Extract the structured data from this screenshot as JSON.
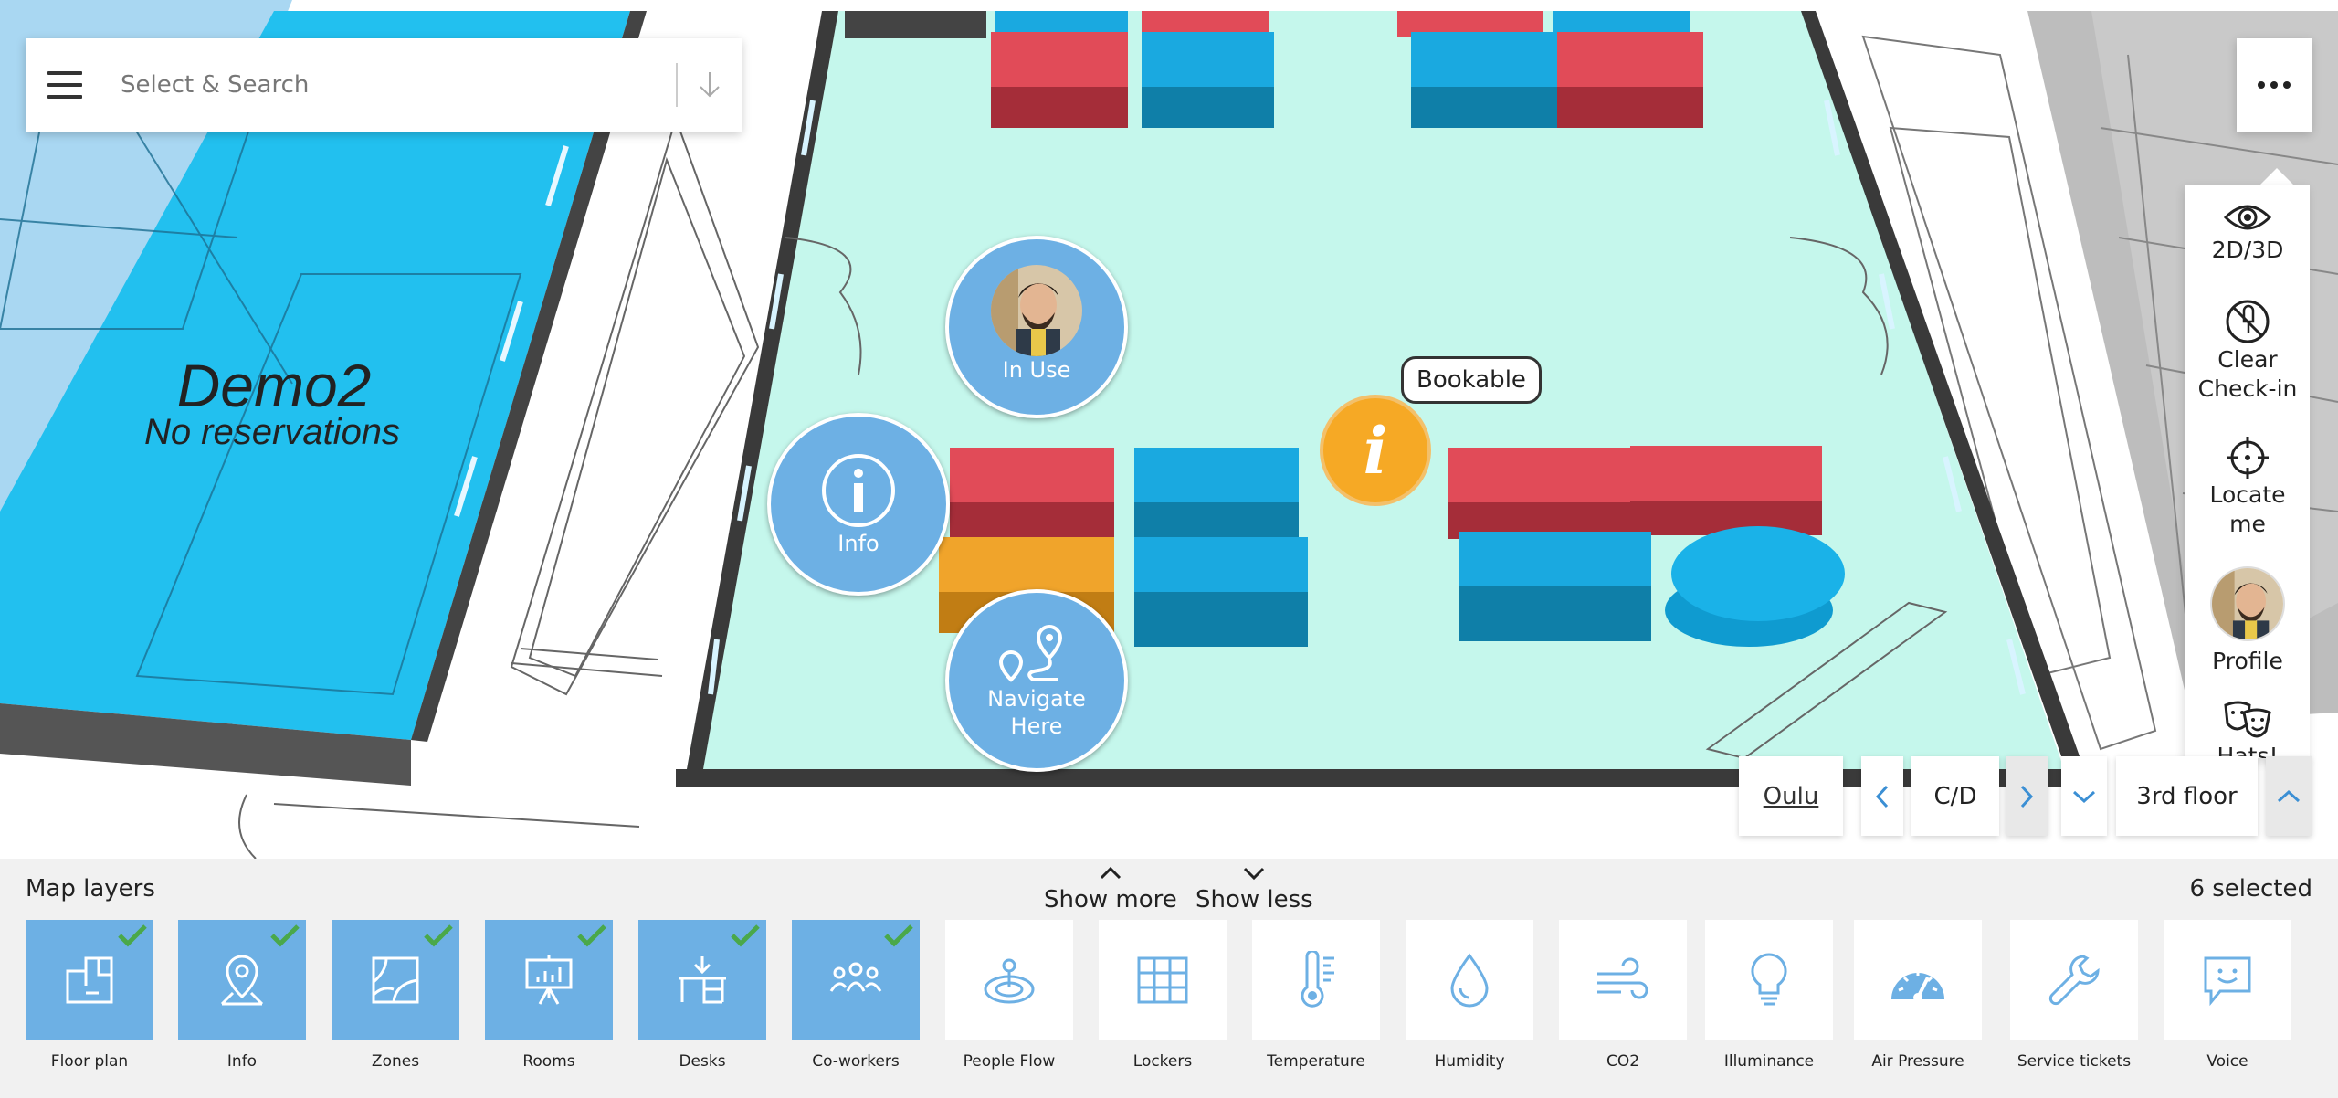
{
  "search": {
    "placeholder": "Select & Search"
  },
  "map": {
    "room_label_line1": "Demo2",
    "room_label_line2": "No reservations",
    "markers": {
      "in_use": "In Use",
      "info": "Info",
      "navigate": "Navigate\nHere",
      "bookable": "Bookable",
      "info_pin_glyph": "i"
    }
  },
  "toolbar": {
    "more_icon": "ellipsis-icon",
    "items": [
      {
        "label": "2D/3D",
        "icon": "eye-icon"
      },
      {
        "label": "Clear\nCheck-in",
        "icon": "clear-checkin-icon"
      },
      {
        "label": "Locate\nme",
        "icon": "crosshair-icon"
      },
      {
        "label": "Profile",
        "icon": "avatar"
      },
      {
        "label": "Hats!",
        "icon": "theater-masks-icon"
      }
    ]
  },
  "floor_selector": {
    "site": "Oulu",
    "building": "C/D",
    "floor": "3rd floor"
  },
  "layers_panel": {
    "title": "Map layers",
    "show_more": "Show more",
    "show_less": "Show less",
    "selected_count": "6 selected",
    "layers": [
      {
        "label": "Floor plan",
        "selected": true,
        "icon": "floor-plan-icon"
      },
      {
        "label": "Info",
        "selected": true,
        "icon": "map-pin-icon"
      },
      {
        "label": "Zones",
        "selected": true,
        "icon": "zones-icon"
      },
      {
        "label": "Rooms",
        "selected": true,
        "icon": "presentation-board-icon"
      },
      {
        "label": "Desks",
        "selected": true,
        "icon": "desk-icon"
      },
      {
        "label": "Co-workers",
        "selected": true,
        "icon": "people-icon"
      },
      {
        "label": "People Flow",
        "selected": false,
        "icon": "people-flow-icon"
      },
      {
        "label": "Lockers",
        "selected": false,
        "icon": "lockers-grid-icon"
      },
      {
        "label": "Temperature",
        "selected": false,
        "icon": "thermometer-icon"
      },
      {
        "label": "Humidity",
        "selected": false,
        "icon": "droplet-icon"
      },
      {
        "label": "CO2",
        "selected": false,
        "icon": "wind-icon"
      },
      {
        "label": "Illuminance",
        "selected": false,
        "icon": "lightbulb-icon"
      },
      {
        "label": "Air Pressure",
        "selected": false,
        "icon": "gauge-icon"
      },
      {
        "label": "Service tickets",
        "selected": false,
        "icon": "wrench-icon"
      },
      {
        "label": "Voice",
        "selected": false,
        "icon": "chat-bubble-icon"
      }
    ]
  },
  "colors": {
    "accent_blue": "#6db0e4",
    "floor_mint": "#c5f7ec",
    "room_cyan": "#22c0ef",
    "desk_red": "#e14b58",
    "desk_blue": "#1aa9e0",
    "desk_orange": "#f0a42b",
    "check_green": "#4aa84a"
  }
}
